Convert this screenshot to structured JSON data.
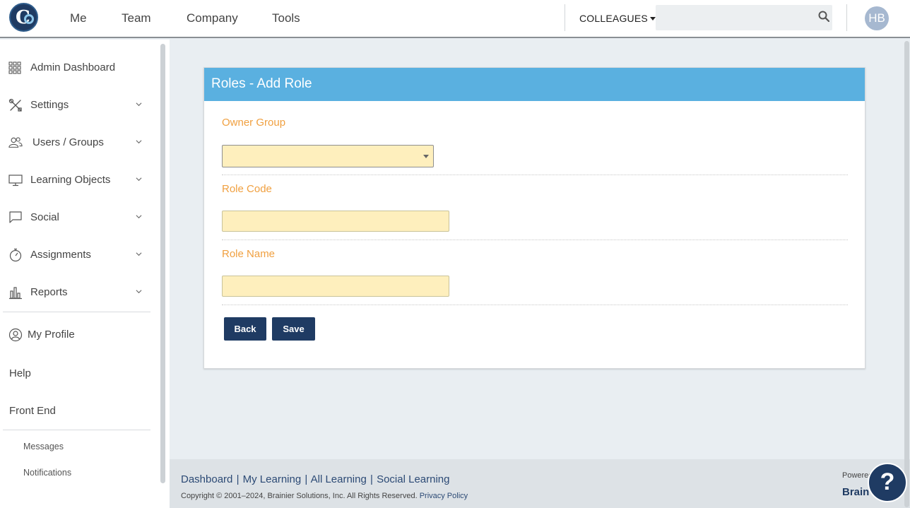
{
  "topbar": {
    "nav": [
      "Me",
      "Team",
      "Company",
      "Tools"
    ],
    "colleagues_label": "COLLEAGUES",
    "search_placeholder": "",
    "avatar_initials": "HB"
  },
  "sidebar": {
    "items": [
      {
        "label": "Admin Dashboard",
        "icon": "grid-icon"
      },
      {
        "label": "Settings",
        "icon": "tools-icon"
      },
      {
        "label": "Users / Groups",
        "icon": "users-icon"
      },
      {
        "label": "Learning Objects",
        "icon": "monitor-icon"
      },
      {
        "label": "Social",
        "icon": "chat-icon"
      },
      {
        "label": "Assignments",
        "icon": "stopwatch-icon"
      },
      {
        "label": "Reports",
        "icon": "bar-chart-icon"
      }
    ],
    "my_profile": "My Profile",
    "help": "Help",
    "front_end": "Front End",
    "messages": "Messages",
    "notifications": "Notifications"
  },
  "form": {
    "title": "Roles - Add Role",
    "owner_group_label": "Owner Group",
    "owner_group_value": "",
    "role_code_label": "Role Code",
    "role_code_value": "",
    "role_name_label": "Role Name",
    "role_name_value": "",
    "back_label": "Back",
    "save_label": "Save"
  },
  "footer": {
    "links": [
      "Dashboard",
      "My Learning",
      "All Learning",
      "Social Learning"
    ],
    "separator": "|",
    "copyright": "Copyright © 2001–2024, Brainier Solutions, Inc. All Rights Reserved.",
    "privacy": "Privacy Policy",
    "powered": "Powered",
    "brand": "Brain"
  },
  "help_button": "?",
  "colors": {
    "navy": "#1f3b63",
    "header_blue": "#5ab0e0",
    "label_orange": "#f0a040",
    "field_yellow": "#feefbd"
  }
}
